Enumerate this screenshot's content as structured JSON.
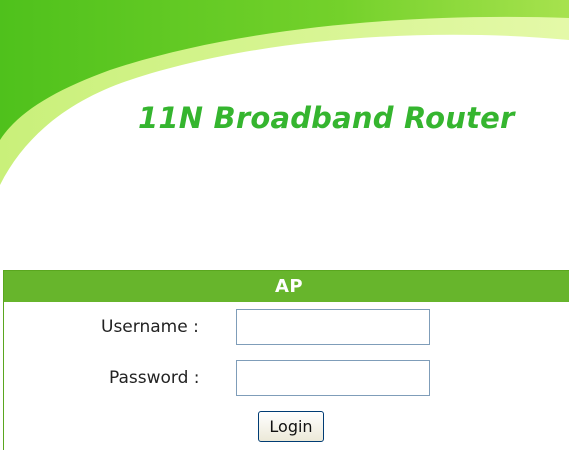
{
  "banner": {
    "title": "11N Broadband Router"
  },
  "login": {
    "header": "AP",
    "username_label": "Username :",
    "username_value": "",
    "password_label": "Password :",
    "password_value": "",
    "button_label": "Login"
  },
  "colors": {
    "brand_green": "#35b52f",
    "header_green": "#67b52c",
    "swoosh_light": "#c8f07a"
  }
}
